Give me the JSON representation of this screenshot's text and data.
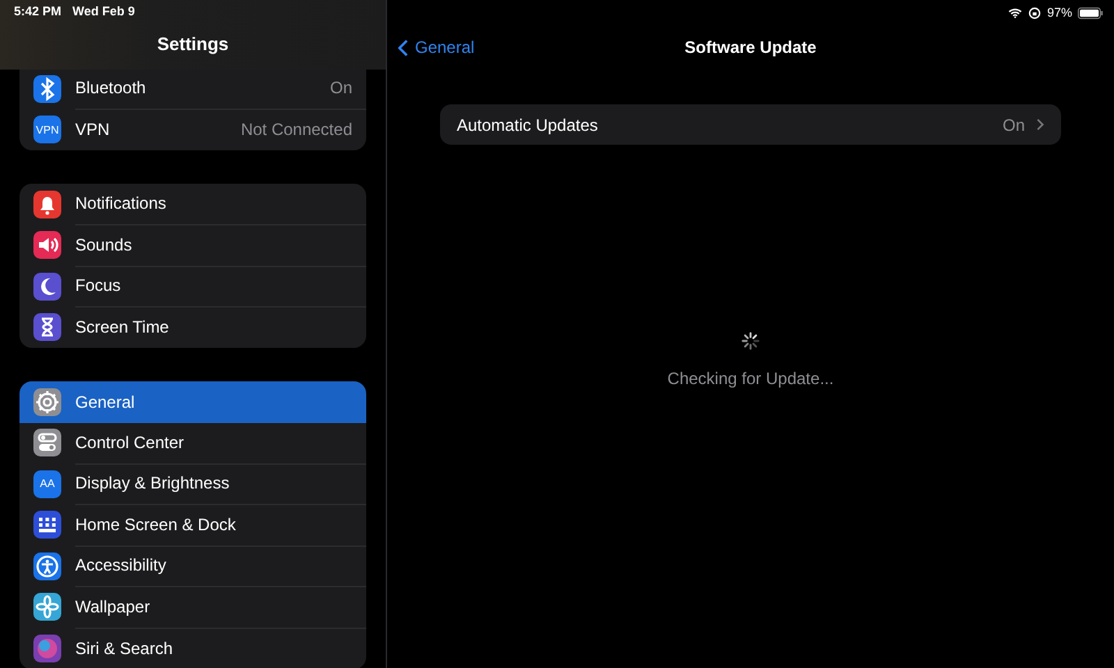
{
  "status_bar": {
    "time": "5:42 PM",
    "date": "Wed Feb 9",
    "battery_text": "97%"
  },
  "sidebar": {
    "title": "Settings",
    "groups": [
      [
        {
          "label": "Bluetooth",
          "value": "On",
          "kind": "bluetooth",
          "color": "#1a73e8",
          "selected": false
        },
        {
          "label": "VPN",
          "value": "Not Connected",
          "kind": "text",
          "icon_text": "VPN",
          "color": "#1a73e8",
          "selected": false
        }
      ],
      [
        {
          "label": "Notifications",
          "kind": "bell",
          "color": "#e5372f",
          "selected": false
        },
        {
          "label": "Sounds",
          "kind": "speaker",
          "color": "#e42a55",
          "selected": false
        },
        {
          "label": "Focus",
          "kind": "moon",
          "color": "#5a4fcf",
          "selected": false
        },
        {
          "label": "Screen Time",
          "kind": "hourglass",
          "color": "#5a4fcf",
          "selected": false
        }
      ],
      [
        {
          "label": "General",
          "kind": "gear",
          "color": "#8e8e93",
          "selected": true
        },
        {
          "label": "Control Center",
          "kind": "toggles",
          "color": "#8e8e93",
          "selected": false
        },
        {
          "label": "Display & Brightness",
          "kind": "text",
          "icon_text": "AA",
          "color": "#1a73e8",
          "selected": false
        },
        {
          "label": "Home Screen & Dock",
          "kind": "grid",
          "color": "#2d4fd8",
          "selected": false
        },
        {
          "label": "Accessibility",
          "kind": "person",
          "color": "#1a73e8",
          "selected": false
        },
        {
          "label": "Wallpaper",
          "kind": "flower",
          "color": "#35a6d6",
          "selected": false
        },
        {
          "label": "Siri & Search",
          "kind": "orb",
          "color": "#7a3fb0",
          "selected": false
        }
      ]
    ]
  },
  "detail": {
    "back_label": "General",
    "title": "Software Update",
    "rows": [
      {
        "label": "Automatic Updates",
        "value": "On"
      }
    ],
    "status_text": "Checking for Update..."
  }
}
